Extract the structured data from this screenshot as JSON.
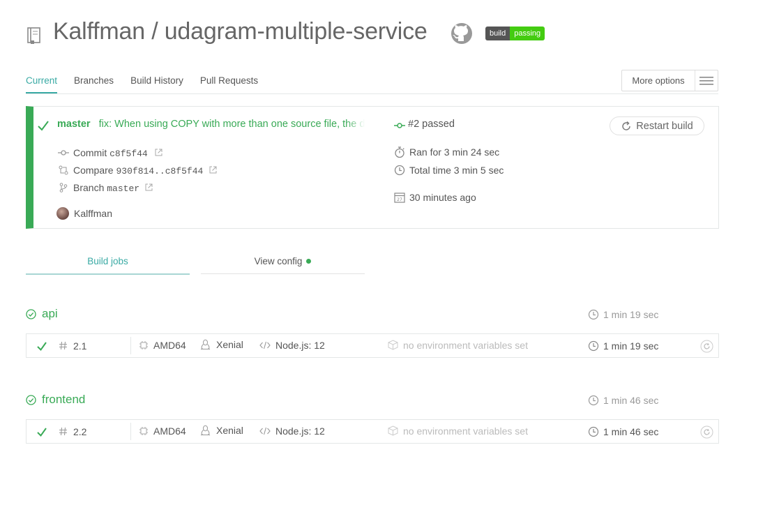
{
  "header": {
    "repo_title": "Kalffman / udagram-multiple-service",
    "badge_left": "build",
    "badge_right": "passing"
  },
  "tabs": [
    {
      "label": "Current",
      "active": true
    },
    {
      "label": "Branches",
      "active": false
    },
    {
      "label": "Build History",
      "active": false
    },
    {
      "label": "Pull Requests",
      "active": false
    }
  ],
  "more_options": "More options",
  "build": {
    "branch": "master",
    "commit_message": "fix: When using COPY with more than one source file, the d",
    "number_status": "#2 passed",
    "restart_label": "Restart build",
    "commit_label": "Commit",
    "commit_sha": "c8f5f44",
    "compare_label": "Compare",
    "compare_range": "930f814..c8f5f44",
    "branch_label": "Branch",
    "branch_value": "master",
    "author": "Kalffman",
    "ran_for": "Ran for 3 min 24 sec",
    "total_time": "Total time 3 min 5 sec",
    "ago": "30 minutes ago",
    "calendar_day": "27"
  },
  "subtabs": {
    "jobs": "Build jobs",
    "config": "View config"
  },
  "stages": [
    {
      "name": "api",
      "time": "1 min 19 sec",
      "job": {
        "number": "2.1",
        "arch": "AMD64",
        "os": "Xenial",
        "lang": "Node.js: 12",
        "env": "no environment variables set",
        "time": "1 min 19 sec"
      }
    },
    {
      "name": "frontend",
      "time": "1 min 46 sec",
      "job": {
        "number": "2.2",
        "arch": "AMD64",
        "os": "Xenial",
        "lang": "Node.js: 12",
        "env": "no environment variables set",
        "time": "1 min 46 sec"
      }
    }
  ],
  "colors": {
    "passed_green": "#39aa56",
    "accent_teal": "#39aaa4",
    "badge_green": "#44cc11",
    "badge_gray": "#555555"
  }
}
